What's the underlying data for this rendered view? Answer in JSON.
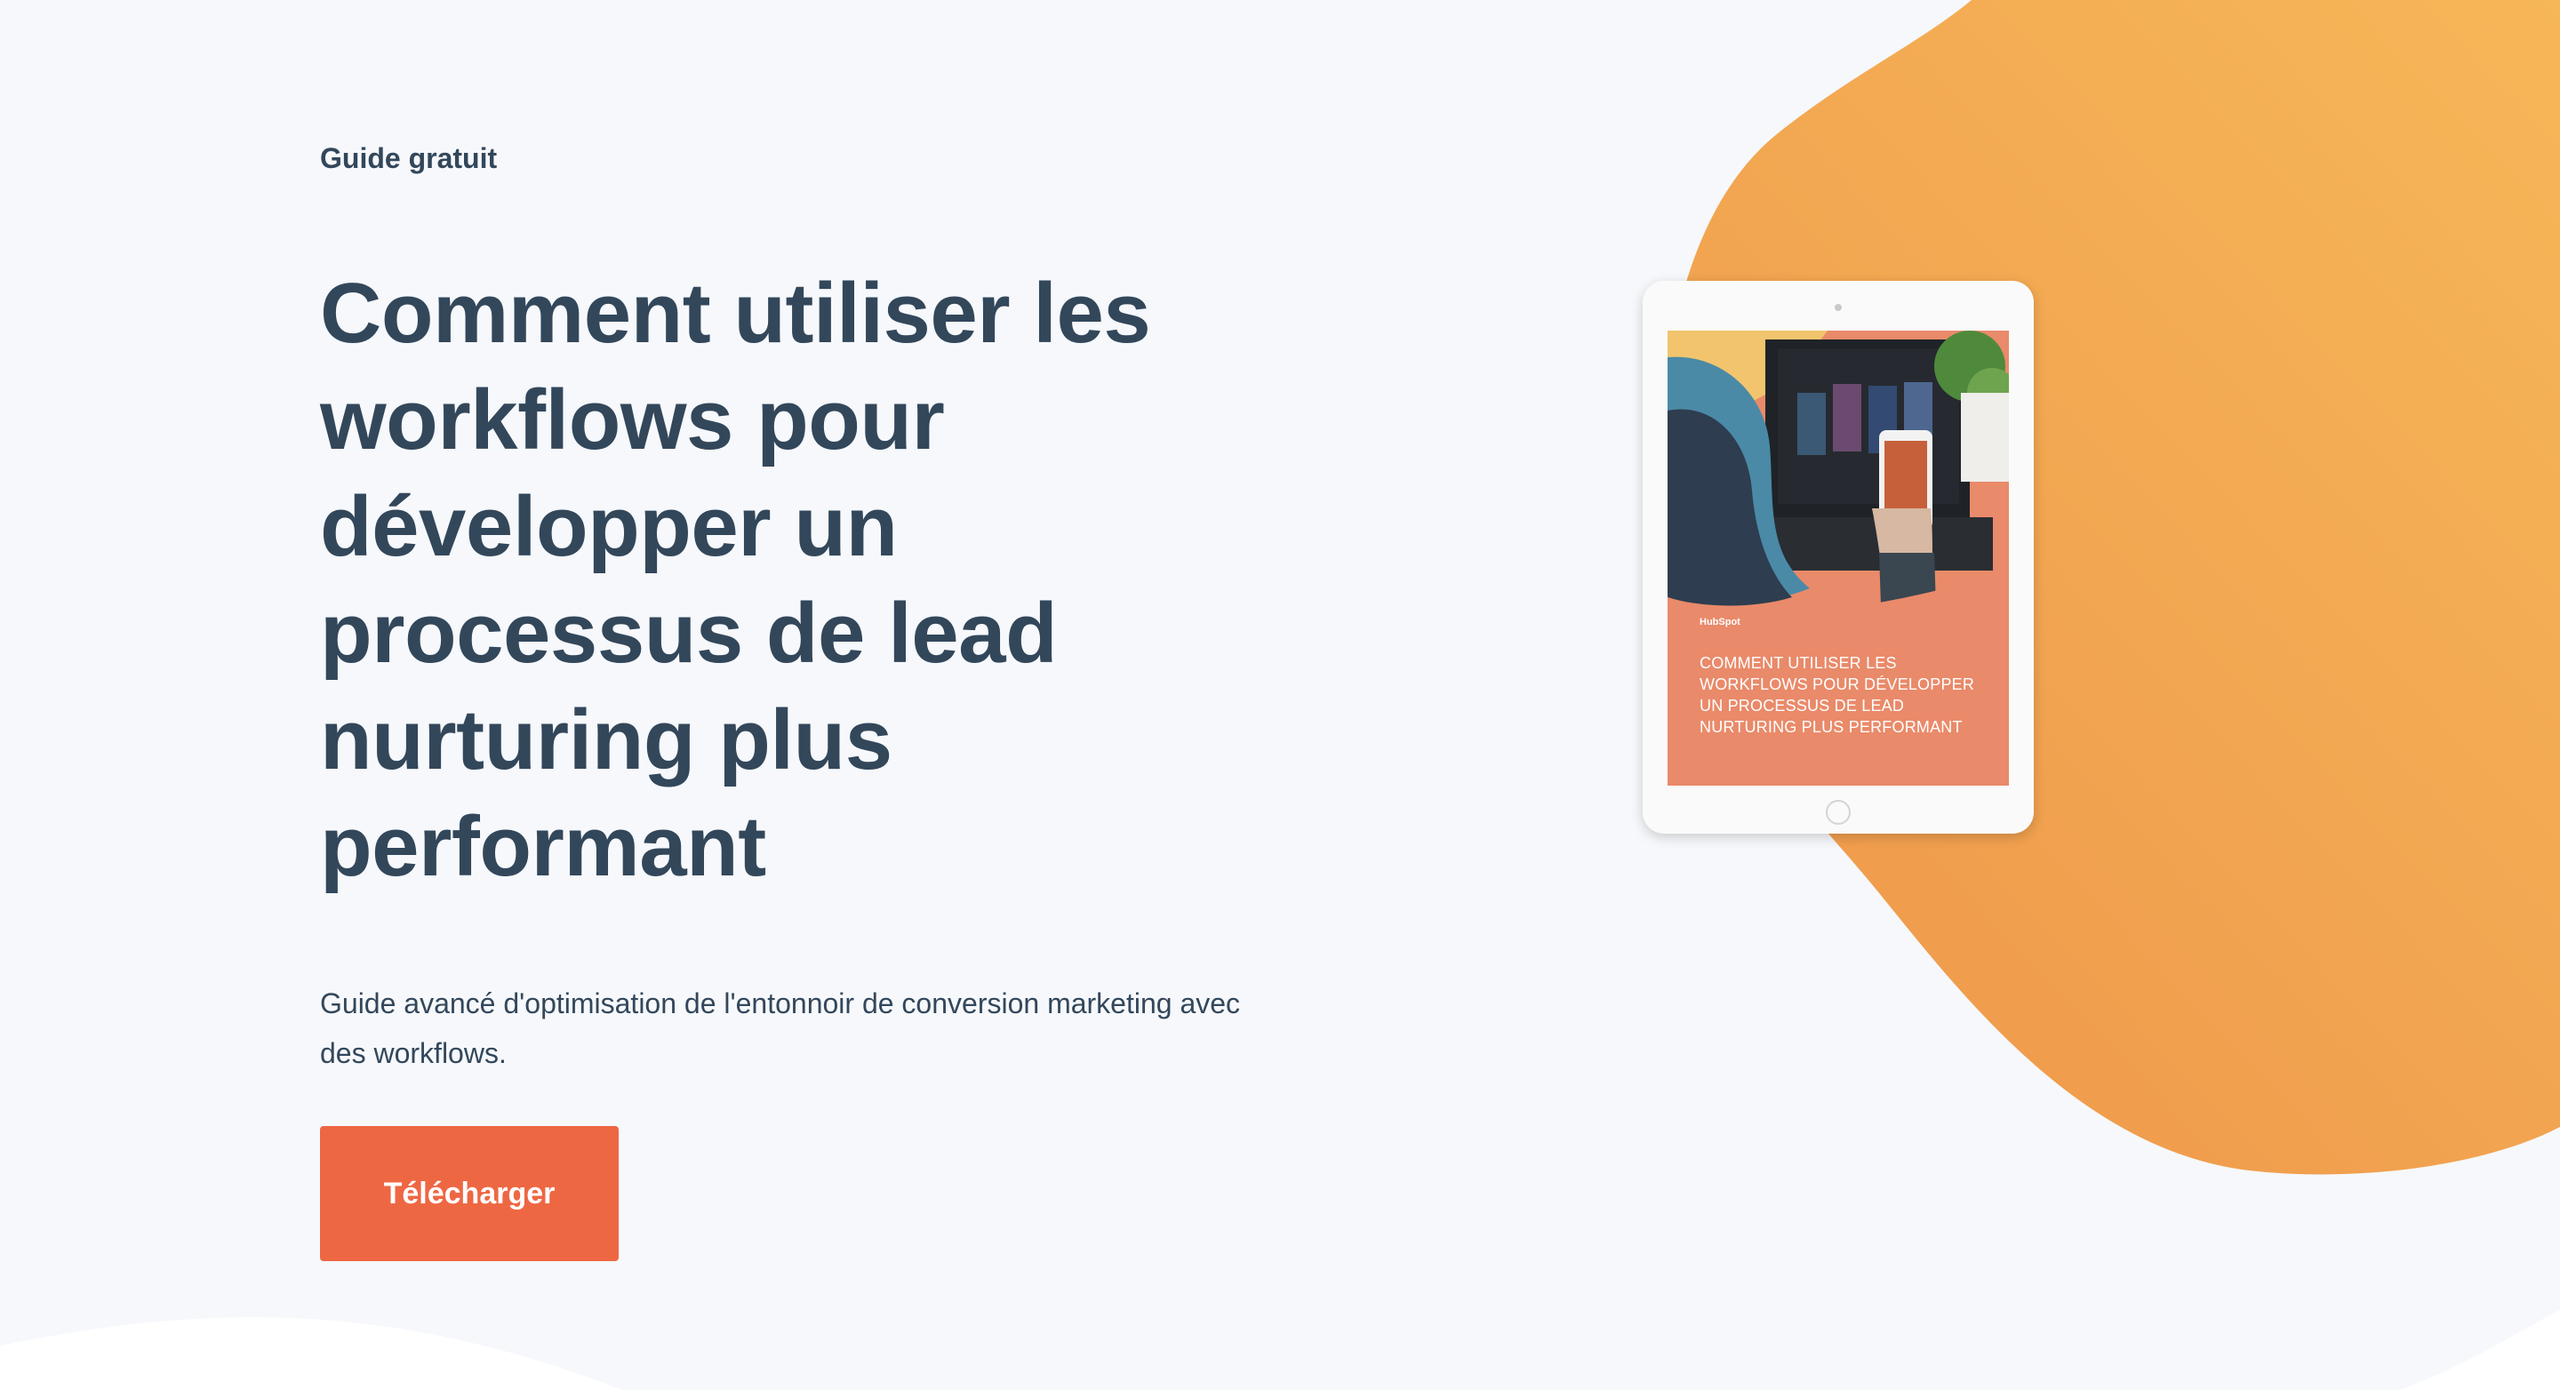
{
  "hero": {
    "eyebrow": "Guide gratuit",
    "title": "Comment utiliser les workflows pour développer un processus de lead nurturing plus performant",
    "description": "Guide avancé d'optimisation de l'entonnoir de conversion marketing avec des workflows.",
    "cta_label": "Télécharger"
  },
  "cover": {
    "brand": "HubSpot",
    "title": "Comment utiliser les workflows pour développer un processus de lead nurturing plus performant"
  },
  "colors": {
    "background": "#f6f8fb",
    "text": "#33475b",
    "accent": "#ee6743",
    "blob_light": "#f5b457",
    "blob_dark": "#ef994b"
  }
}
